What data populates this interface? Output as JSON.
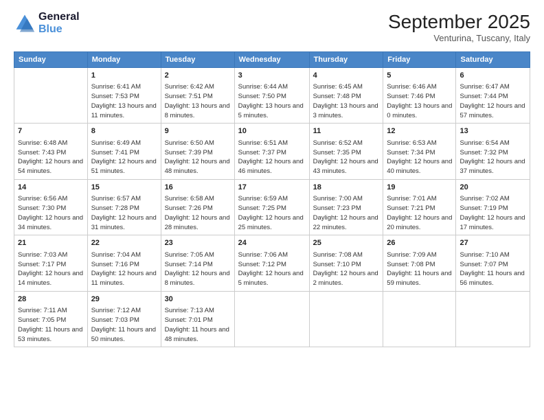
{
  "logo": {
    "line1": "General",
    "line2": "Blue"
  },
  "title": "September 2025",
  "subtitle": "Venturina, Tuscany, Italy",
  "days_header": [
    "Sunday",
    "Monday",
    "Tuesday",
    "Wednesday",
    "Thursday",
    "Friday",
    "Saturday"
  ],
  "weeks": [
    [
      {
        "day": "",
        "sunrise": "",
        "sunset": "",
        "daylight": ""
      },
      {
        "day": "1",
        "sunrise": "Sunrise: 6:41 AM",
        "sunset": "Sunset: 7:53 PM",
        "daylight": "Daylight: 13 hours and 11 minutes."
      },
      {
        "day": "2",
        "sunrise": "Sunrise: 6:42 AM",
        "sunset": "Sunset: 7:51 PM",
        "daylight": "Daylight: 13 hours and 8 minutes."
      },
      {
        "day": "3",
        "sunrise": "Sunrise: 6:44 AM",
        "sunset": "Sunset: 7:50 PM",
        "daylight": "Daylight: 13 hours and 5 minutes."
      },
      {
        "day": "4",
        "sunrise": "Sunrise: 6:45 AM",
        "sunset": "Sunset: 7:48 PM",
        "daylight": "Daylight: 13 hours and 3 minutes."
      },
      {
        "day": "5",
        "sunrise": "Sunrise: 6:46 AM",
        "sunset": "Sunset: 7:46 PM",
        "daylight": "Daylight: 13 hours and 0 minutes."
      },
      {
        "day": "6",
        "sunrise": "Sunrise: 6:47 AM",
        "sunset": "Sunset: 7:44 PM",
        "daylight": "Daylight: 12 hours and 57 minutes."
      }
    ],
    [
      {
        "day": "7",
        "sunrise": "Sunrise: 6:48 AM",
        "sunset": "Sunset: 7:43 PM",
        "daylight": "Daylight: 12 hours and 54 minutes."
      },
      {
        "day": "8",
        "sunrise": "Sunrise: 6:49 AM",
        "sunset": "Sunset: 7:41 PM",
        "daylight": "Daylight: 12 hours and 51 minutes."
      },
      {
        "day": "9",
        "sunrise": "Sunrise: 6:50 AM",
        "sunset": "Sunset: 7:39 PM",
        "daylight": "Daylight: 12 hours and 48 minutes."
      },
      {
        "day": "10",
        "sunrise": "Sunrise: 6:51 AM",
        "sunset": "Sunset: 7:37 PM",
        "daylight": "Daylight: 12 hours and 46 minutes."
      },
      {
        "day": "11",
        "sunrise": "Sunrise: 6:52 AM",
        "sunset": "Sunset: 7:35 PM",
        "daylight": "Daylight: 12 hours and 43 minutes."
      },
      {
        "day": "12",
        "sunrise": "Sunrise: 6:53 AM",
        "sunset": "Sunset: 7:34 PM",
        "daylight": "Daylight: 12 hours and 40 minutes."
      },
      {
        "day": "13",
        "sunrise": "Sunrise: 6:54 AM",
        "sunset": "Sunset: 7:32 PM",
        "daylight": "Daylight: 12 hours and 37 minutes."
      }
    ],
    [
      {
        "day": "14",
        "sunrise": "Sunrise: 6:56 AM",
        "sunset": "Sunset: 7:30 PM",
        "daylight": "Daylight: 12 hours and 34 minutes."
      },
      {
        "day": "15",
        "sunrise": "Sunrise: 6:57 AM",
        "sunset": "Sunset: 7:28 PM",
        "daylight": "Daylight: 12 hours and 31 minutes."
      },
      {
        "day": "16",
        "sunrise": "Sunrise: 6:58 AM",
        "sunset": "Sunset: 7:26 PM",
        "daylight": "Daylight: 12 hours and 28 minutes."
      },
      {
        "day": "17",
        "sunrise": "Sunrise: 6:59 AM",
        "sunset": "Sunset: 7:25 PM",
        "daylight": "Daylight: 12 hours and 25 minutes."
      },
      {
        "day": "18",
        "sunrise": "Sunrise: 7:00 AM",
        "sunset": "Sunset: 7:23 PM",
        "daylight": "Daylight: 12 hours and 22 minutes."
      },
      {
        "day": "19",
        "sunrise": "Sunrise: 7:01 AM",
        "sunset": "Sunset: 7:21 PM",
        "daylight": "Daylight: 12 hours and 20 minutes."
      },
      {
        "day": "20",
        "sunrise": "Sunrise: 7:02 AM",
        "sunset": "Sunset: 7:19 PM",
        "daylight": "Daylight: 12 hours and 17 minutes."
      }
    ],
    [
      {
        "day": "21",
        "sunrise": "Sunrise: 7:03 AM",
        "sunset": "Sunset: 7:17 PM",
        "daylight": "Daylight: 12 hours and 14 minutes."
      },
      {
        "day": "22",
        "sunrise": "Sunrise: 7:04 AM",
        "sunset": "Sunset: 7:16 PM",
        "daylight": "Daylight: 12 hours and 11 minutes."
      },
      {
        "day": "23",
        "sunrise": "Sunrise: 7:05 AM",
        "sunset": "Sunset: 7:14 PM",
        "daylight": "Daylight: 12 hours and 8 minutes."
      },
      {
        "day": "24",
        "sunrise": "Sunrise: 7:06 AM",
        "sunset": "Sunset: 7:12 PM",
        "daylight": "Daylight: 12 hours and 5 minutes."
      },
      {
        "day": "25",
        "sunrise": "Sunrise: 7:08 AM",
        "sunset": "Sunset: 7:10 PM",
        "daylight": "Daylight: 12 hours and 2 minutes."
      },
      {
        "day": "26",
        "sunrise": "Sunrise: 7:09 AM",
        "sunset": "Sunset: 7:08 PM",
        "daylight": "Daylight: 11 hours and 59 minutes."
      },
      {
        "day": "27",
        "sunrise": "Sunrise: 7:10 AM",
        "sunset": "Sunset: 7:07 PM",
        "daylight": "Daylight: 11 hours and 56 minutes."
      }
    ],
    [
      {
        "day": "28",
        "sunrise": "Sunrise: 7:11 AM",
        "sunset": "Sunset: 7:05 PM",
        "daylight": "Daylight: 11 hours and 53 minutes."
      },
      {
        "day": "29",
        "sunrise": "Sunrise: 7:12 AM",
        "sunset": "Sunset: 7:03 PM",
        "daylight": "Daylight: 11 hours and 50 minutes."
      },
      {
        "day": "30",
        "sunrise": "Sunrise: 7:13 AM",
        "sunset": "Sunset: 7:01 PM",
        "daylight": "Daylight: 11 hours and 48 minutes."
      },
      {
        "day": "",
        "sunrise": "",
        "sunset": "",
        "daylight": ""
      },
      {
        "day": "",
        "sunrise": "",
        "sunset": "",
        "daylight": ""
      },
      {
        "day": "",
        "sunrise": "",
        "sunset": "",
        "daylight": ""
      },
      {
        "day": "",
        "sunrise": "",
        "sunset": "",
        "daylight": ""
      }
    ]
  ]
}
